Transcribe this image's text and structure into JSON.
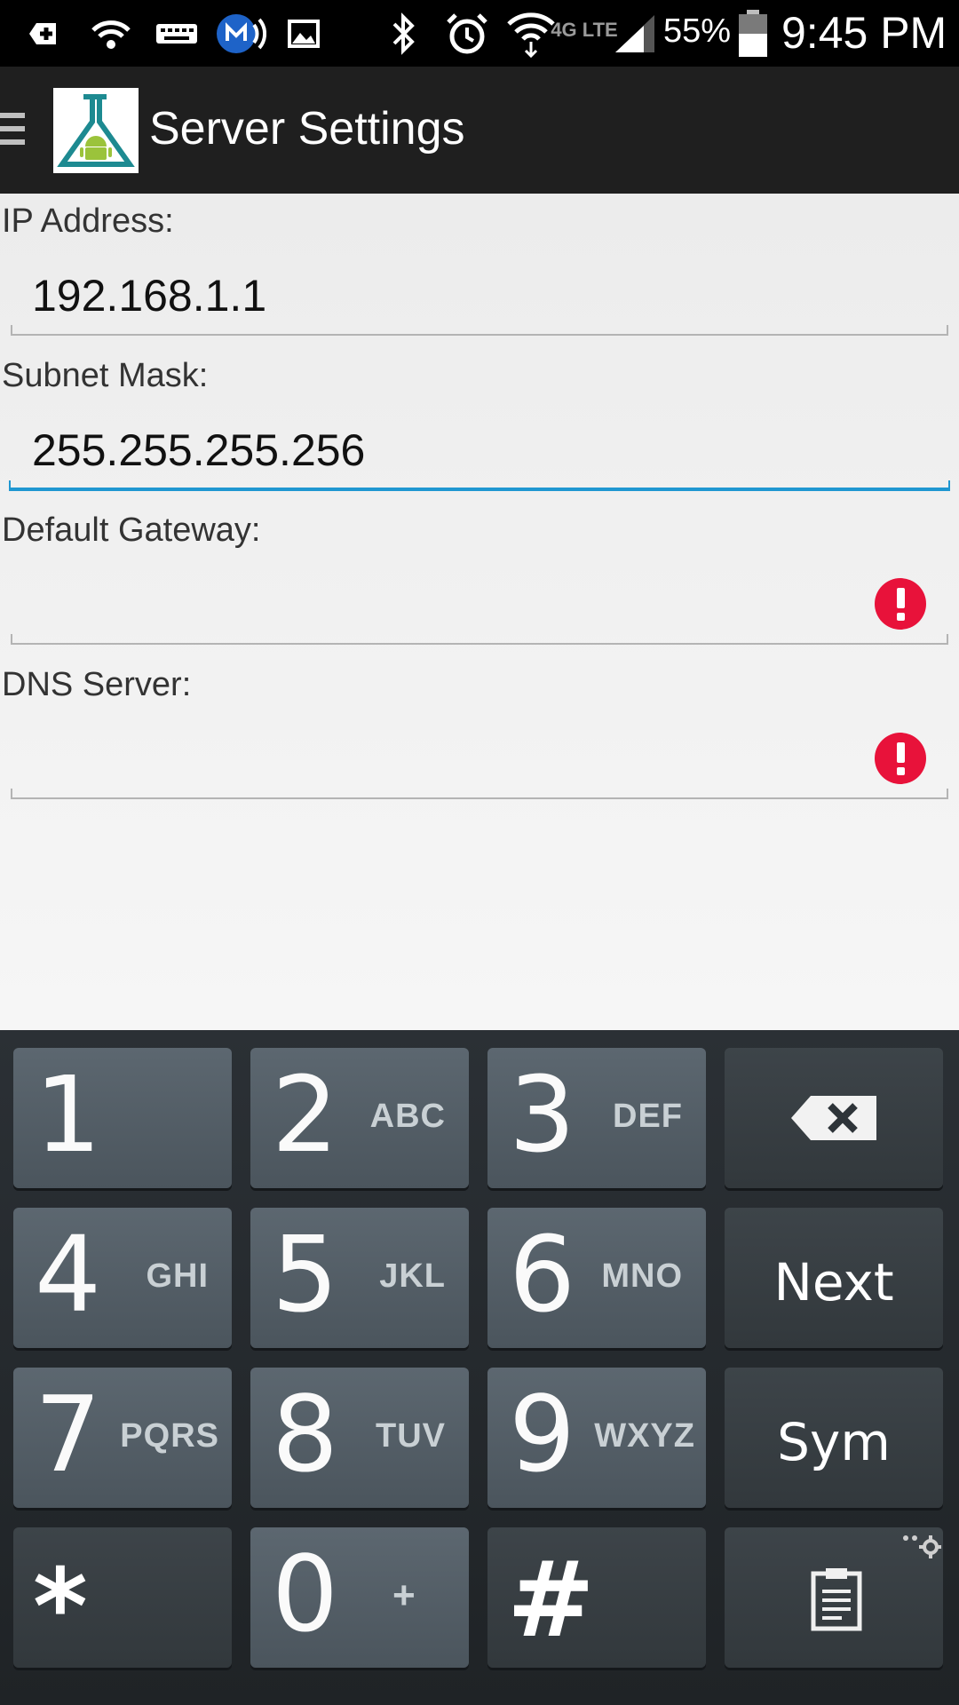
{
  "status_bar": {
    "battery_percent": "55%",
    "time": "9:45 PM",
    "network_label": "4G LTE",
    "icons": [
      "add-icon",
      "wifi-hotspot-icon",
      "keyboard-icon",
      "carrier-icon",
      "image-icon",
      "bluetooth-icon",
      "alarm-icon",
      "wifi-icon",
      "network-4g-icon",
      "signal-icon",
      "battery-icon"
    ]
  },
  "action_bar": {
    "title": "Server Settings",
    "menu_icon": "hamburger-menu-icon",
    "logo_icon": "android-flask-logo"
  },
  "form": {
    "fields": [
      {
        "label": "IP Address:",
        "value": "192.168.1.1",
        "focused": false,
        "error": false
      },
      {
        "label": "Subnet Mask:",
        "value": "255.255.255.256",
        "focused": true,
        "error": false
      },
      {
        "label": "Default Gateway:",
        "value": "",
        "focused": false,
        "error": true
      },
      {
        "label": "DNS Server:",
        "value": "",
        "focused": false,
        "error": true
      }
    ],
    "error_icon": "error-exclamation-icon",
    "error_color": "#e8123a",
    "focus_color": "#1f97d1"
  },
  "keyboard": {
    "rows": [
      [
        {
          "digit": "1",
          "letters": ""
        },
        {
          "digit": "2",
          "letters": "ABC"
        },
        {
          "digit": "3",
          "letters": "DEF"
        },
        {
          "icon": "backspace-icon"
        }
      ],
      [
        {
          "digit": "4",
          "letters": "GHI"
        },
        {
          "digit": "5",
          "letters": "JKL"
        },
        {
          "digit": "6",
          "letters": "MNO"
        },
        {
          "word": "Next"
        }
      ],
      [
        {
          "digit": "7",
          "letters": "PQRS"
        },
        {
          "digit": "8",
          "letters": "TUV"
        },
        {
          "digit": "9",
          "letters": "WXYZ"
        },
        {
          "word": "Sym"
        }
      ],
      [
        {
          "glyph": "*"
        },
        {
          "digit": "0",
          "letters": "+"
        },
        {
          "glyph": "#"
        },
        {
          "icon": "clipboard-icon"
        }
      ]
    ]
  }
}
